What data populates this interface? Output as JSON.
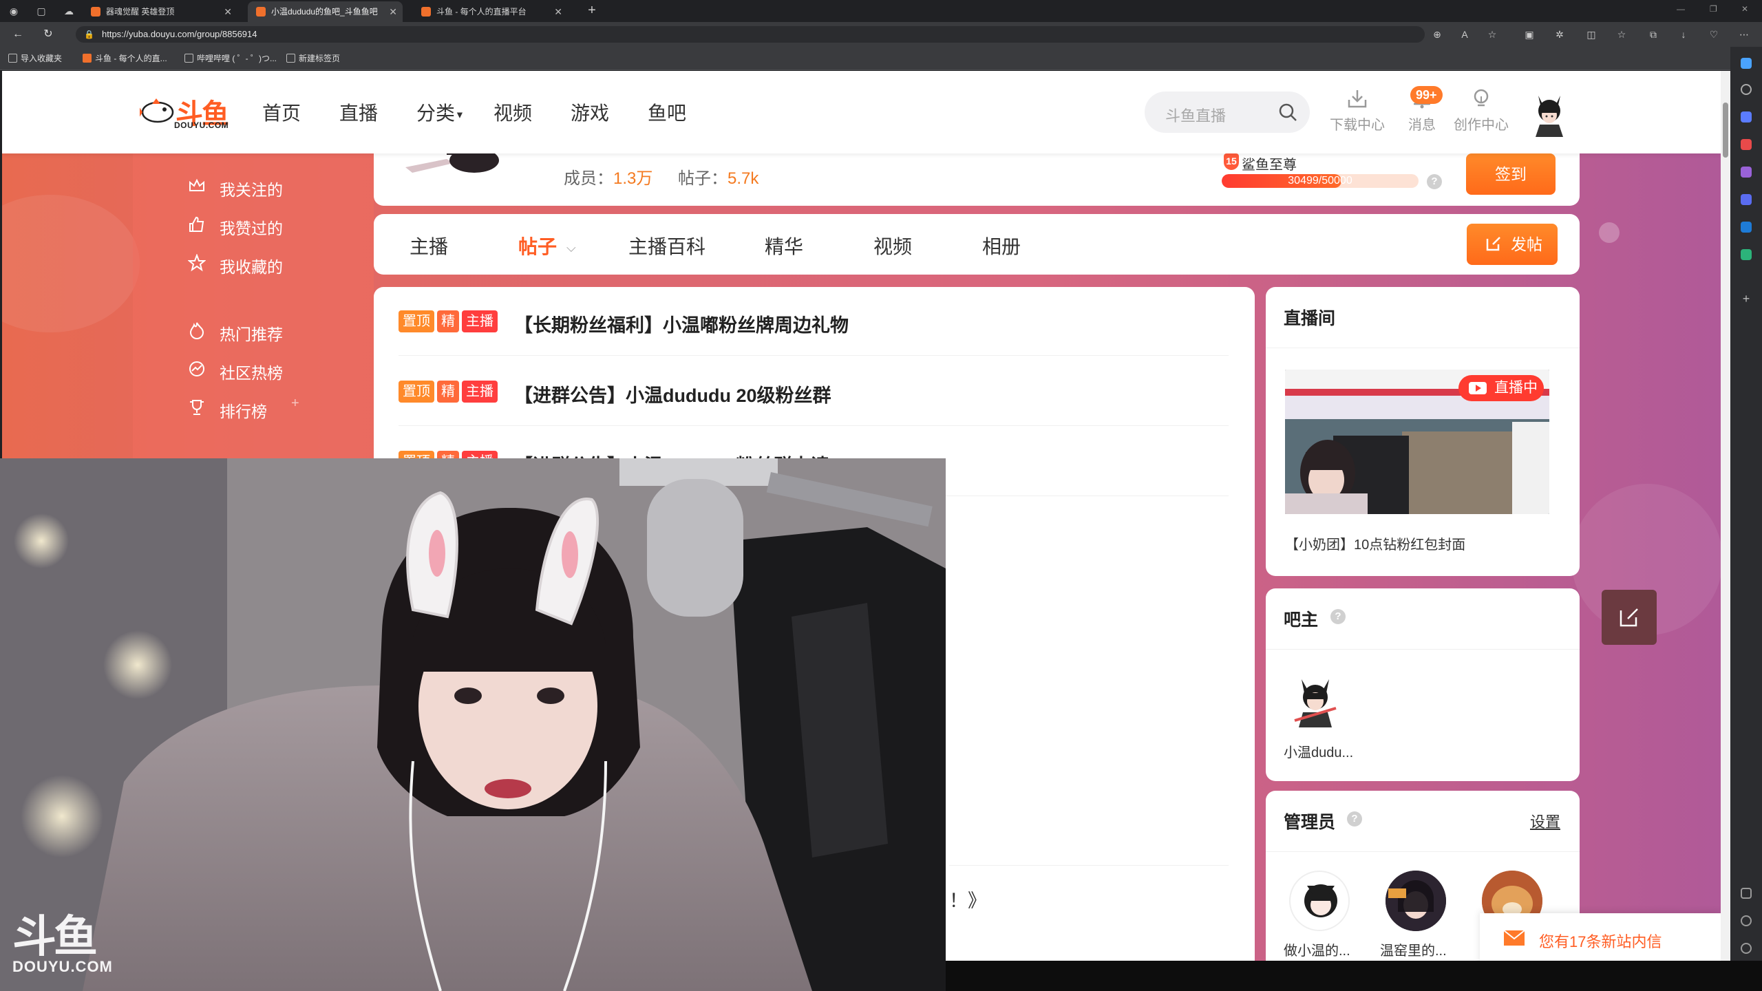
{
  "browser": {
    "tabs": [
      {
        "title": "器魂觉醒 英雄登顶"
      },
      {
        "title": "小温dududu的鱼吧_斗鱼鱼吧"
      },
      {
        "title": "斗鱼 - 每个人的直播平台"
      }
    ],
    "url": "https://yuba.douyu.com/group/8856914",
    "bookmarks": [
      {
        "label": "导入收藏夹"
      },
      {
        "label": "斗鱼 - 每个人的直..."
      },
      {
        "label": "哔哩哔哩 ( ゜- ゜)つ..."
      },
      {
        "label": "新建标签页"
      }
    ]
  },
  "header": {
    "logo_text": "斗鱼",
    "logo_sub": "DOUYU.COM",
    "nav": [
      "首页",
      "直播",
      "分类",
      "视频",
      "游戏",
      "鱼吧"
    ],
    "search_placeholder": "斗鱼直播",
    "actions": {
      "download": "下载中心",
      "messages": "消息",
      "messages_badge": "99+",
      "creator": "创作中心"
    }
  },
  "sidebar": {
    "items": [
      "我关注的",
      "我赞过的",
      "我收藏的",
      "热门推荐",
      "社区热榜",
      "排行榜"
    ],
    "plus": "+"
  },
  "group_info": {
    "members_label": "成员：",
    "members_value": "1.3万",
    "posts_label": "帖子：",
    "posts_value": "5.7k",
    "rank_level": "15",
    "rank_title": "鲨鱼至尊",
    "xp_current": "30499",
    "xp_total": "50000",
    "xp_fraction": 0.61,
    "signin": "签到"
  },
  "group_tabs": {
    "items": [
      "主播",
      "帖子",
      "主播百科",
      "精华",
      "视频",
      "相册"
    ],
    "active": "帖子",
    "post_button": "发帖"
  },
  "posts": {
    "tag_labels": {
      "top": "置顶",
      "jing": "精",
      "anchor": "主播"
    },
    "items": [
      {
        "title": "【长期粉丝福利】小温嘟粉丝牌周边礼物"
      },
      {
        "title": "【进群公告】小温dududu 20级粉丝群"
      },
      {
        "title": "【进群公告】小温dududu 粉丝群申请"
      }
    ],
    "partial_tail": "！》"
  },
  "live_room": {
    "title": "直播间",
    "badge": "直播中",
    "caption": "【小奶团】10点钻粉红包封面"
  },
  "owner": {
    "title": "吧主",
    "name": "小温dudu..."
  },
  "admins": {
    "title": "管理员",
    "settings": "设置",
    "names": [
      "做小温的...",
      "温窑里的...",
      ""
    ]
  },
  "notice": {
    "text": "您有17条新站内信"
  },
  "watermark": {
    "text": "斗鱼",
    "sub": "DOUYU.COM"
  },
  "colors": {
    "brand_orange": "#ff5d23",
    "accent_orange": "#f47a20",
    "tag_top": "#ff8a2a",
    "tag_anchor": "#ff3e3e",
    "live_red": "#ff3b30"
  }
}
